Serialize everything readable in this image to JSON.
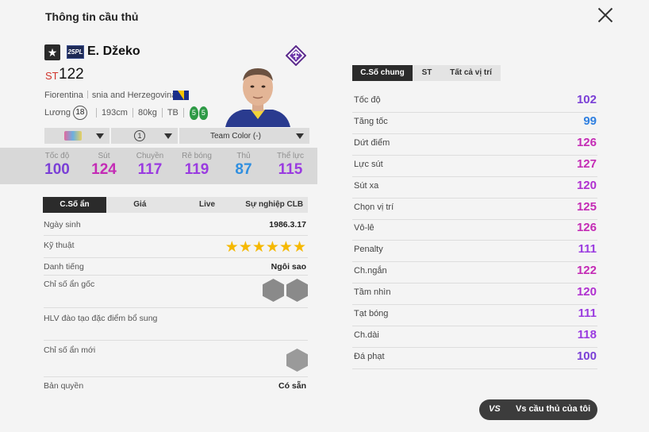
{
  "header": {
    "title": "Thông tin cầu thủ"
  },
  "player": {
    "season_badge": "25PL",
    "name": "E. Džeko",
    "position": "ST",
    "ovr": "122",
    "club": "Fiorentina",
    "nationality": "snia and Herzegovina",
    "wage_label": "Lương",
    "wage": "18",
    "height": "193cm",
    "weight": "80kg",
    "body_type": "TB",
    "foot_left": "5",
    "foot_right": "5"
  },
  "dropdowns": {
    "level": "1",
    "team_color": "Team Color (-)"
  },
  "main_stats": [
    {
      "label": "Tốc độ",
      "value": "100",
      "color": "#7a3fd6"
    },
    {
      "label": "Sút",
      "value": "124",
      "color": "#c42bb5"
    },
    {
      "label": "Chuyền",
      "value": "117",
      "color": "#9a3be0"
    },
    {
      "label": "Rê bóng",
      "value": "119",
      "color": "#9a3be0"
    },
    {
      "label": "Thủ",
      "value": "87",
      "color": "#2f8fe0"
    },
    {
      "label": "Thể lực",
      "value": "115",
      "color": "#9a3be0"
    }
  ],
  "left_tabs": [
    "C.Số ẩn",
    "Giá",
    "Live",
    "Sự nghiệp CLB"
  ],
  "info": {
    "birth_label": "Ngày sinh",
    "birth": "1986.3.17",
    "skill_label": "Kỹ thuật",
    "skill_stars": "★★★★★★",
    "rep_label": "Danh tiếng",
    "rep": "Ngôi sao",
    "hidden_label": "Chỉ số ẩn gốc",
    "coach_label": "HLV đào tạo đặc điểm bổ sung",
    "new_hidden_label": "Chỉ số ẩn mới",
    "license_label": "Bản quyền",
    "license": "Có sẵn"
  },
  "right_tabs": [
    "C.Số chung",
    "ST",
    "Tất cả vị trí"
  ],
  "attributes": [
    {
      "label": "Tốc độ",
      "value": "102",
      "color": "#7a3fd6"
    },
    {
      "label": "Tăng tốc",
      "value": "99",
      "color": "#2f7fe0"
    },
    {
      "label": "Dứt điểm",
      "value": "126",
      "color": "#c42bb5"
    },
    {
      "label": "Lực sút",
      "value": "127",
      "color": "#c42bb5"
    },
    {
      "label": "Sút xa",
      "value": "120",
      "color": "#b030d0"
    },
    {
      "label": "Chọn vị trí",
      "value": "125",
      "color": "#c42bb5"
    },
    {
      "label": "Vô-lê",
      "value": "126",
      "color": "#c42bb5"
    },
    {
      "label": "Penalty",
      "value": "111",
      "color": "#9a3be0"
    },
    {
      "label": "Ch.ngắn",
      "value": "122",
      "color": "#c42bb5"
    },
    {
      "label": "Tầm nhìn",
      "value": "120",
      "color": "#b030d0"
    },
    {
      "label": "Tạt bóng",
      "value": "111",
      "color": "#9a3be0"
    },
    {
      "label": "Ch.dài",
      "value": "118",
      "color": "#9a3be0"
    },
    {
      "label": "Đá phạt",
      "value": "100",
      "color": "#7a3fd6"
    }
  ],
  "compare_button": {
    "icon": "VS",
    "label": "Vs cầu thủ của tôi"
  }
}
